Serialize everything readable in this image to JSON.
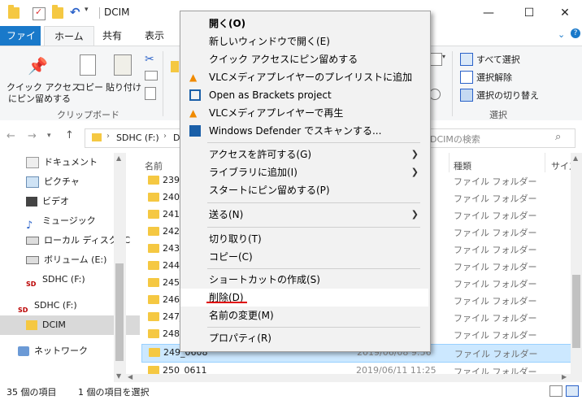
{
  "window": {
    "title": "DCIM",
    "minimize": "—",
    "maximize": "☐",
    "close": "✕"
  },
  "tabs": {
    "file": "ファイル",
    "home": "ホーム",
    "share": "共有",
    "view": "表示"
  },
  "ribbon": {
    "pin_quick_access": "クイック アクセス",
    "pin_quick_access_2": "にピン留めする",
    "copy": "コピー",
    "paste": "貼り付け",
    "clipboard_group": "クリップボード",
    "select_all": "すべて選択",
    "select_none": "選択解除",
    "invert_selection": "選択の切り替え",
    "select_group": "選択"
  },
  "address": {
    "path": "SDHC (F:)",
    "path_partial": "D",
    "search_placeholder": "DCIMの検索"
  },
  "nav": {
    "items": [
      {
        "label": "ドキュメント"
      },
      {
        "label": "ピクチャ"
      },
      {
        "label": "ビデオ"
      },
      {
        "label": "ミュージック"
      },
      {
        "label": "ローカル ディスク (C"
      },
      {
        "label": "ボリューム (E:)"
      },
      {
        "label": "SDHC (F:)"
      },
      {
        "label": "SDHC (F:)"
      },
      {
        "label": "DCIM"
      },
      {
        "label": "ネットワーク"
      }
    ]
  },
  "list": {
    "col_name": "名前",
    "col_type": "種類",
    "col_size": "サイズ",
    "rows": [
      {
        "name": "239_0",
        "date": "",
        "kind": "ファイル フォルダー"
      },
      {
        "name": "240_0",
        "date": "",
        "kind": "ファイル フォルダー"
      },
      {
        "name": "241_0",
        "date": "",
        "kind": "ファイル フォルダー"
      },
      {
        "name": "242_0",
        "date": "",
        "kind": "ファイル フォルダー"
      },
      {
        "name": "243_0",
        "date": "",
        "kind": "ファイル フォルダー"
      },
      {
        "name": "244_0",
        "date": "",
        "kind": "ファイル フォルダー"
      },
      {
        "name": "245_0",
        "date": "",
        "kind": "ファイル フォルダー"
      },
      {
        "name": "246_0",
        "date": "",
        "kind": "ファイル フォルダー"
      },
      {
        "name": "247_0",
        "date": "",
        "kind": "ファイル フォルダー"
      },
      {
        "name": "248_0",
        "date": "",
        "kind": "ファイル フォルダー"
      },
      {
        "name": "249_0608",
        "date": "2019/06/08 9:56",
        "kind": "ファイル フォルダー"
      },
      {
        "name": "250_0611",
        "date": "2019/06/11 11:25",
        "kind": "ファイル フォルダー"
      }
    ]
  },
  "status": {
    "item_count": "35 個の項目",
    "selected_count": "1 個の項目を選択"
  },
  "context_menu": {
    "items": [
      {
        "label": "開く(O)"
      },
      {
        "label": "新しいウィンドウで開く(E)"
      },
      {
        "label": "クイック アクセスにピン留めする"
      },
      {
        "label": "VLCメディアプレイヤーのプレイリストに追加"
      },
      {
        "label": "Open as Brackets project"
      },
      {
        "label": "VLCメディアプレイヤーで再生"
      },
      {
        "label": "Windows Defender でスキャンする..."
      },
      {
        "label": "アクセスを許可する(G)"
      },
      {
        "label": "ライブラリに追加(I)"
      },
      {
        "label": "スタートにピン留めする(P)"
      },
      {
        "label": "送る(N)"
      },
      {
        "label": "切り取り(T)"
      },
      {
        "label": "コピー(C)"
      },
      {
        "label": "ショートカットの作成(S)"
      },
      {
        "label": "削除(D)"
      },
      {
        "label": "名前の変更(M)"
      },
      {
        "label": "プロパティ(R)"
      }
    ]
  },
  "colors": {
    "accent": "#1979ca",
    "selection": "#cce8ff",
    "highlight_underline": "#e00000"
  }
}
